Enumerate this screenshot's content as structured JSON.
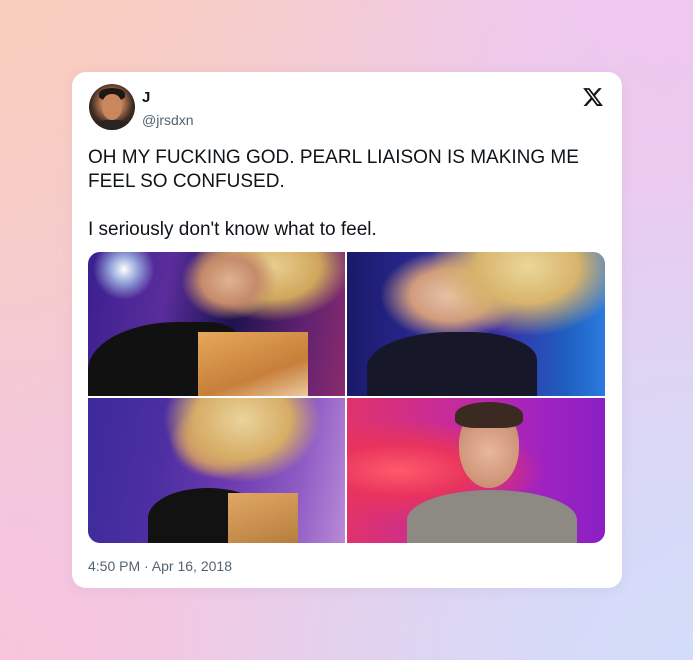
{
  "tweet": {
    "author_name": "J",
    "author_handle": "@jrsdxn",
    "text_line1": "OH MY FUCKING GOD. PEARL LIAISON IS MAKING ME FEEL SO CONFUSED.",
    "text_line2": "I seriously don't know what to feel.",
    "timestamp": "4:50 PM · Apr 16, 2018",
    "media_count": 4
  },
  "icons": {
    "brand": "x-logo-icon",
    "avatar": "avatar-photo"
  },
  "colors": {
    "text_primary": "#0f1419",
    "text_secondary": "#536471",
    "card_background": "#ffffff"
  }
}
